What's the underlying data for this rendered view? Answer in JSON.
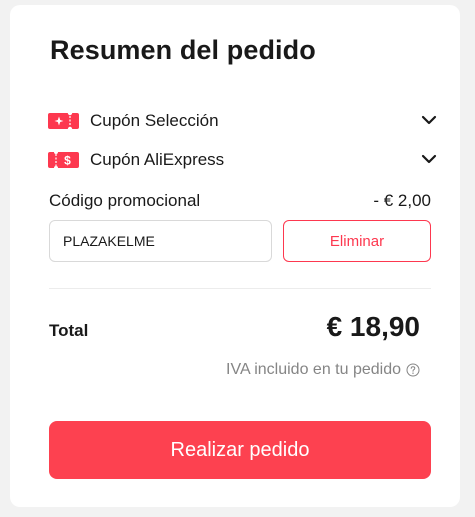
{
  "summary": {
    "title": "Resumen del pedido"
  },
  "coupons": [
    {
      "label": "Cupón Selección",
      "icon": "coupon-selection-icon",
      "badge_symbol": "✦"
    },
    {
      "label": "Cupón AliExpress",
      "icon": "coupon-aliexpress-icon",
      "badge_symbol": "$"
    }
  ],
  "promo": {
    "label": "Código promocional",
    "discount": "- € 2,00",
    "code_value": "PLAZAKELME",
    "remove_label": "Eliminar"
  },
  "total": {
    "label": "Total",
    "value": "€ 18,90",
    "tax_note": "IVA incluido en tu pedido"
  },
  "actions": {
    "place_order_label": "Realizar pedido"
  },
  "colors": {
    "accent": "#fd4150",
    "accent_border": "#fd384f",
    "text": "#191919",
    "muted": "#858585"
  }
}
